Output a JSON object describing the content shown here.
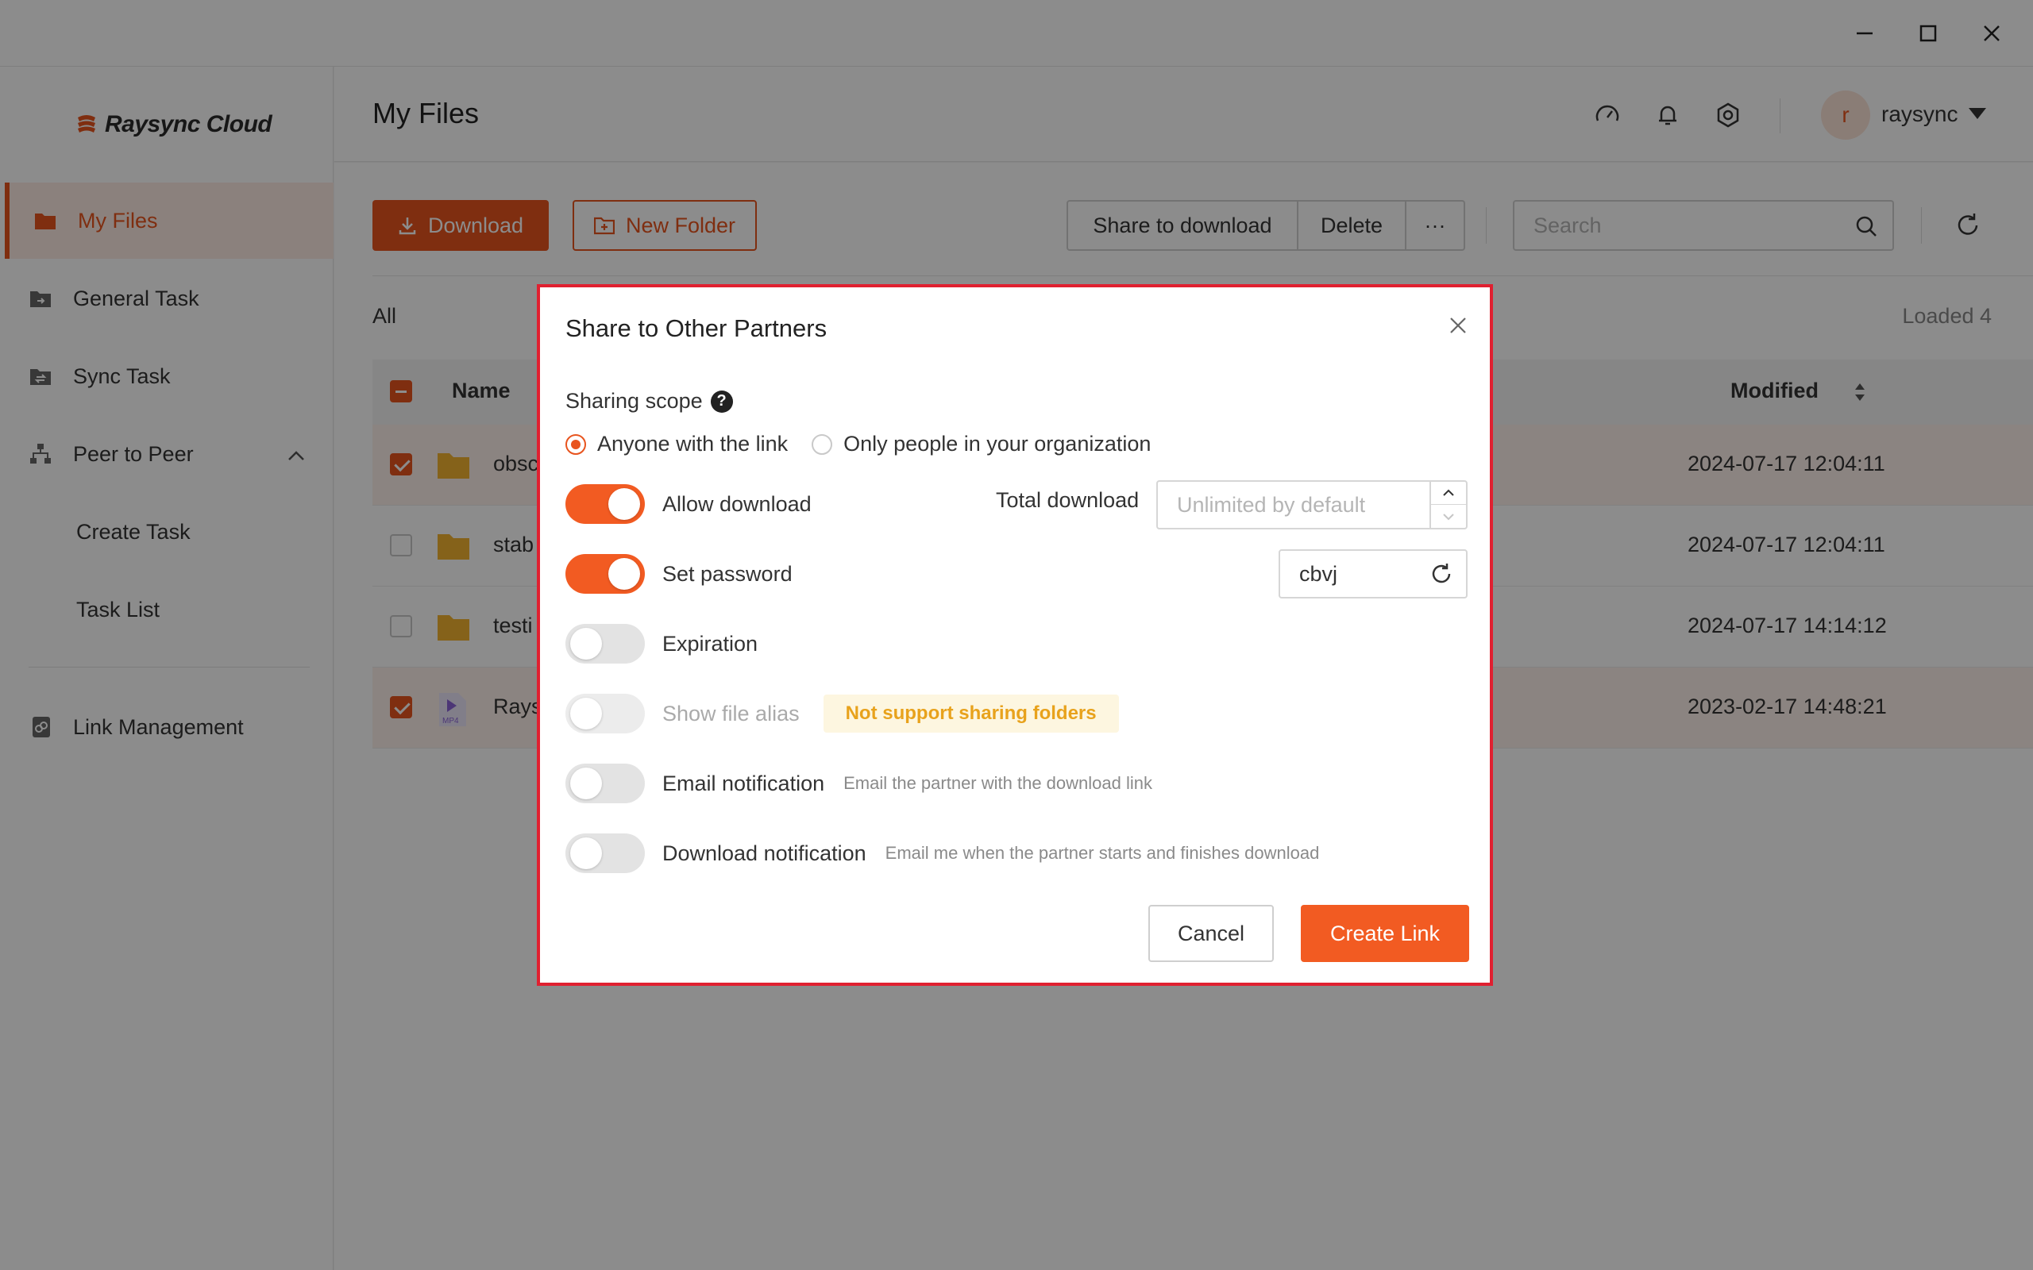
{
  "app": {
    "logo_text": "Raysync Cloud",
    "accent_color": "#e8541e",
    "window_controls": [
      "minimize-icon",
      "maximize-icon",
      "close-icon"
    ]
  },
  "sidebar": {
    "items": [
      {
        "label": "My Files",
        "icon": "folder-icon",
        "active": true
      },
      {
        "label": "General Task",
        "icon": "task-icon"
      },
      {
        "label": "Sync Task",
        "icon": "sync-icon"
      },
      {
        "label": "Peer to Peer",
        "icon": "network-icon",
        "expanded": true
      },
      {
        "label": "Create Task",
        "sub": true
      },
      {
        "label": "Task List",
        "sub": true
      },
      {
        "label": "Link Management",
        "icon": "link-icon"
      }
    ]
  },
  "header": {
    "title": "My Files",
    "icons": [
      "speedometer-icon",
      "bell-icon",
      "settings-icon"
    ],
    "avatar_letter": "r",
    "username": "raysync"
  },
  "toolbar": {
    "download_label": "Download",
    "new_folder_label": "New Folder",
    "share_label": "Share to download",
    "delete_label": "Delete",
    "more_label": "···",
    "search_placeholder": "Search"
  },
  "list": {
    "filter_label": "All",
    "loaded_label": "Loaded 4",
    "columns": {
      "name": "Name",
      "modified": "Modified"
    },
    "rows": [
      {
        "name": "obsc",
        "type": "folder",
        "modified": "2024-07-17 12:04:11",
        "checked": true
      },
      {
        "name": "stab",
        "type": "folder",
        "modified": "2024-07-17 12:04:11",
        "checked": false
      },
      {
        "name": "testi",
        "type": "folder",
        "modified": "2024-07-17 14:14:12",
        "checked": false
      },
      {
        "name": "Rays",
        "type": "mp4",
        "file_badge": "MP4",
        "modified": "2023-02-17 14:48:21",
        "checked": true
      }
    ]
  },
  "modal": {
    "title": "Share to Other Partners",
    "scope_label": "Sharing scope",
    "scope_options": [
      "Anyone with the link",
      "Only people in your organization"
    ],
    "scope_selected": 0,
    "allow_download_label": "Allow download",
    "total_download_label": "Total download",
    "total_download_placeholder": "Unlimited by default",
    "set_password_label": "Set password",
    "password_value": "cbvj",
    "expiration_label": "Expiration",
    "show_alias_label": "Show file alias",
    "alias_warning": "Not support sharing folders",
    "email_notification_label": "Email notification",
    "email_notification_hint": "Email the partner with the download link",
    "download_notification_label": "Download notification",
    "download_notification_hint": "Email me when the partner starts and finishes download",
    "cancel_label": "Cancel",
    "create_label": "Create Link",
    "toggles": {
      "allow_download": true,
      "set_password": true,
      "expiration": false,
      "show_alias": false,
      "email_notification": false,
      "download_notification": false
    }
  }
}
